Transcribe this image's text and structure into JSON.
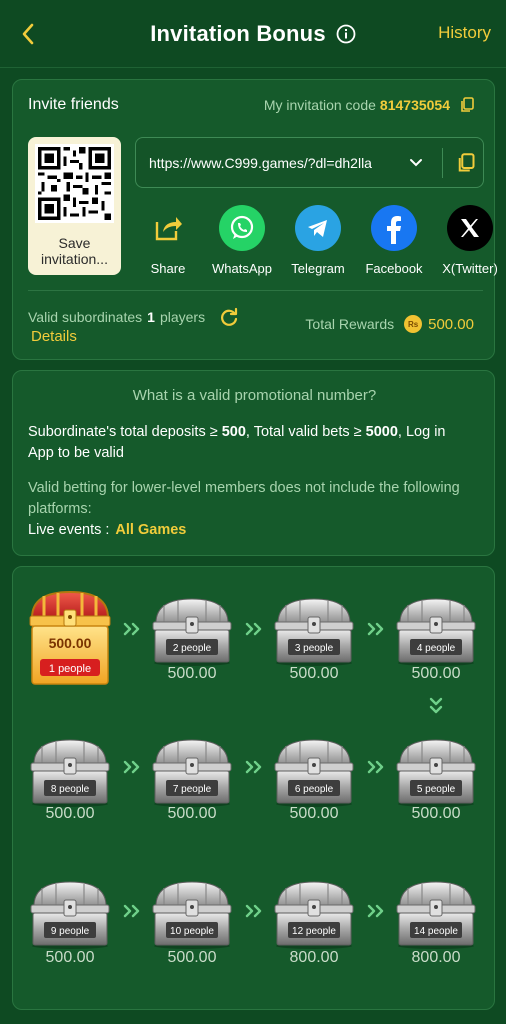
{
  "header": {
    "title": "Invitation Bonus",
    "history": "History"
  },
  "invite": {
    "title": "Invite friends",
    "code_label": "My invitation code",
    "code_value": "814735054",
    "save_label": "Save invitation...",
    "url": "https://www.C999.games/?dl=dh2lla",
    "share": [
      {
        "label": "Share",
        "icon": "share-icon",
        "color": "#f1cc3b"
      },
      {
        "label": "WhatsApp",
        "icon": "whatsapp-icon",
        "color": "#25d366"
      },
      {
        "label": "Telegram",
        "icon": "telegram-icon",
        "color": "#2aa3e3"
      },
      {
        "label": "Facebook",
        "icon": "facebook-icon",
        "color": "#1877f2"
      },
      {
        "label": "X(Twitter)",
        "icon": "x-icon",
        "color": "#000000"
      }
    ],
    "subs_label": "Valid subordinates",
    "subs_count": "1",
    "subs_unit": "players",
    "details": "Details",
    "rewards_label": "Total Rewards",
    "rewards_currency": "Rs",
    "rewards_value": "500.00"
  },
  "promo": {
    "title": "What is a valid promotional number?",
    "line1_a": "Subordinate's total deposits ≥ ",
    "line1_b": "500",
    "line1_c": ", Total valid bets ≥ ",
    "line1_d": "5000",
    "line1_e": ", Log in App to be valid",
    "note": "Valid betting for lower-level members does not include the following platforms:",
    "live_label": "Live events :",
    "live_value": "All Games"
  },
  "chests": [
    {
      "people": "1 people",
      "amount": "500.00",
      "state": "gold"
    },
    {
      "people": "2 people",
      "amount": "500.00",
      "state": "silver"
    },
    {
      "people": "3 people",
      "amount": "500.00",
      "state": "silver"
    },
    {
      "people": "4 people",
      "amount": "500.00",
      "state": "silver"
    },
    {
      "people": "8 people",
      "amount": "500.00",
      "state": "silver"
    },
    {
      "people": "7 people",
      "amount": "500.00",
      "state": "silver"
    },
    {
      "people": "6 people",
      "amount": "500.00",
      "state": "silver"
    },
    {
      "people": "5 people",
      "amount": "500.00",
      "state": "silver"
    },
    {
      "people": "9 people",
      "amount": "500.00",
      "state": "silver"
    },
    {
      "people": "10 people",
      "amount": "500.00",
      "state": "silver"
    },
    {
      "people": "12 people",
      "amount": "800.00",
      "state": "silver"
    },
    {
      "people": "14 people",
      "amount": "800.00",
      "state": "silver"
    }
  ],
  "colors": {
    "background": "#0e4a22",
    "card": "#155a2b",
    "accent": "#f1cc3b"
  }
}
